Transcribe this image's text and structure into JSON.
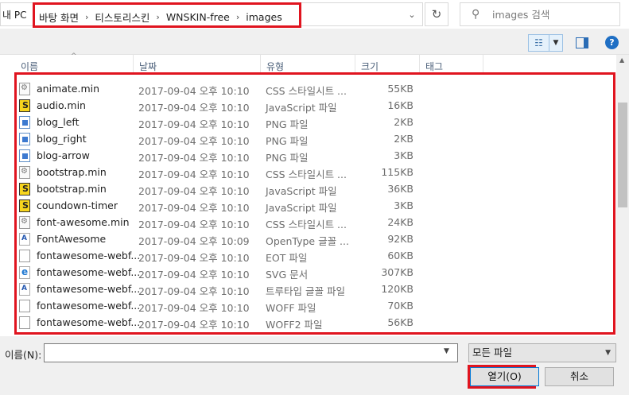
{
  "address": {
    "pc_label": "내 PC",
    "crumbs": [
      "바탕 화면",
      "티스토리스킨",
      "WNSKIN-free",
      "images"
    ],
    "separator": "›"
  },
  "search": {
    "placeholder": "images 검색"
  },
  "columns": {
    "name": "이름",
    "date": "날짜",
    "type": "유형",
    "size": "크기",
    "tags": "태그"
  },
  "files": [
    {
      "name": "animate.min",
      "date": "2017-09-04 오후 10:10",
      "type": "CSS 스타일시트 ...",
      "size": "55KB",
      "icon": "css-file-icon"
    },
    {
      "name": "audio.min",
      "date": "2017-09-04 오후 10:10",
      "type": "JavaScript 파일",
      "size": "16KB",
      "icon": "js-file-icon"
    },
    {
      "name": "blog_left",
      "date": "2017-09-04 오후 10:10",
      "type": "PNG 파일",
      "size": "2KB",
      "icon": "png-file-icon"
    },
    {
      "name": "blog_right",
      "date": "2017-09-04 오후 10:10",
      "type": "PNG 파일",
      "size": "2KB",
      "icon": "png-file-icon"
    },
    {
      "name": "blog-arrow",
      "date": "2017-09-04 오후 10:10",
      "type": "PNG 파일",
      "size": "3KB",
      "icon": "png-file-icon"
    },
    {
      "name": "bootstrap.min",
      "date": "2017-09-04 오후 10:10",
      "type": "CSS 스타일시트 ...",
      "size": "115KB",
      "icon": "css-file-icon"
    },
    {
      "name": "bootstrap.min",
      "date": "2017-09-04 오후 10:10",
      "type": "JavaScript 파일",
      "size": "36KB",
      "icon": "js-file-icon"
    },
    {
      "name": "coundown-timer",
      "date": "2017-09-04 오후 10:10",
      "type": "JavaScript 파일",
      "size": "3KB",
      "icon": "js-file-icon"
    },
    {
      "name": "font-awesome.min",
      "date": "2017-09-04 오후 10:10",
      "type": "CSS 스타일시트 ...",
      "size": "24KB",
      "icon": "css-file-icon"
    },
    {
      "name": "FontAwesome",
      "date": "2017-09-04 오후 10:09",
      "type": "OpenType 글꼴 ...",
      "size": "92KB",
      "icon": "font-file-icon"
    },
    {
      "name": "fontawesome-webf...",
      "date": "2017-09-04 오후 10:10",
      "type": "EOT 파일",
      "size": "60KB",
      "icon": "blank-file-icon"
    },
    {
      "name": "fontawesome-webf...",
      "date": "2017-09-04 오후 10:10",
      "type": "SVG 문서",
      "size": "307KB",
      "icon": "svg-file-icon"
    },
    {
      "name": "fontawesome-webf...",
      "date": "2017-09-04 오후 10:10",
      "type": "트루타입 글꼴 파일",
      "size": "120KB",
      "icon": "font-file-icon"
    },
    {
      "name": "fontawesome-webf...",
      "date": "2017-09-04 오후 10:10",
      "type": "WOFF 파일",
      "size": "70KB",
      "icon": "blank-file-icon"
    },
    {
      "name": "fontawesome-webf...",
      "date": "2017-09-04 오후 10:10",
      "type": "WOFF2 파일",
      "size": "56KB",
      "icon": "blank-file-icon"
    }
  ],
  "bottom": {
    "filename_label": "이름(N):",
    "filename_value": "",
    "filetype_selected": "모든 파일",
    "open_label": "열기(O)",
    "cancel_label": "취소"
  },
  "colors": {
    "highlight": "#e0141f",
    "accent": "#0078d7"
  }
}
